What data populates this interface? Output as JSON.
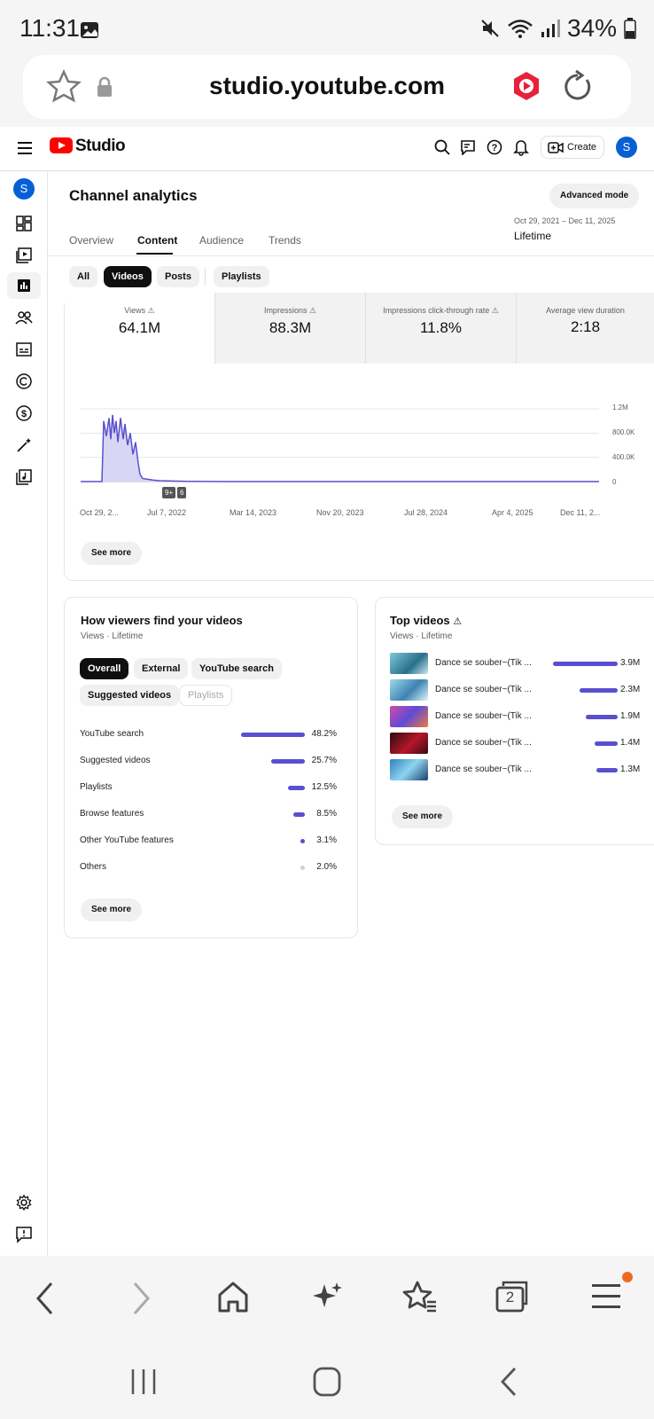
{
  "status": {
    "time": "11:31",
    "battery": "34%"
  },
  "browser": {
    "url": "studio.youtube.com",
    "tabs_count": "2"
  },
  "header": {
    "logo_text": "Studio",
    "create_label": "Create",
    "avatar": "S"
  },
  "sidebar": {
    "avatar": "S"
  },
  "page": {
    "title": "Channel analytics",
    "advanced_mode": "Advanced mode",
    "tabs": [
      "Overview",
      "Content",
      "Audience",
      "Trends"
    ],
    "active_tab": "Content",
    "date_range": "Oct 29, 2021 – Dec 11, 2025",
    "date_label": "Lifetime",
    "filters": [
      "All",
      "Videos",
      "Posts",
      "Playlists"
    ],
    "active_filter": "Videos"
  },
  "metrics": [
    {
      "label": "Views",
      "value": "64.1M"
    },
    {
      "label": "Impressions",
      "value": "88.3M"
    },
    {
      "label": "Impressions click-through rate",
      "value": "11.8%"
    },
    {
      "label": "Average view duration",
      "value": "2:18"
    }
  ],
  "chart_data": {
    "type": "area",
    "series": [
      {
        "name": "Views",
        "values": [
          0,
          0,
          1000000,
          700000,
          60000,
          5000,
          0,
          0,
          0,
          0,
          0
        ]
      }
    ],
    "x_ticks": [
      "Oct 29, 2...",
      "Jul 7, 2022",
      "Mar 14, 2023",
      "Nov 20, 2023",
      "Jul 28, 2024",
      "Apr 4, 2025",
      "Dec 11, 2..."
    ],
    "y_ticks": [
      "1.2M",
      "800.0K",
      "400.0K",
      "0"
    ],
    "ylim": [
      0,
      1200000
    ],
    "markers": [
      "9+",
      "6"
    ],
    "see_more": "See more"
  },
  "traffic": {
    "title": "How viewers find your videos",
    "subtitle": "Views · Lifetime",
    "chips": [
      "Overall",
      "External",
      "YouTube search",
      "Suggested videos",
      "Playlists"
    ],
    "sources": [
      {
        "label": "YouTube search",
        "pct": "48.2%",
        "value": 48.2
      },
      {
        "label": "Suggested videos",
        "pct": "25.7%",
        "value": 25.7
      },
      {
        "label": "Playlists",
        "pct": "12.5%",
        "value": 12.5
      },
      {
        "label": "Browse features",
        "pct": "8.5%",
        "value": 8.5
      },
      {
        "label": "Other YouTube features",
        "pct": "3.1%",
        "value": 3.1
      },
      {
        "label": "Others",
        "pct": "2.0%",
        "value": 2.0
      }
    ],
    "see_more": "See more"
  },
  "top_videos": {
    "title": "Top videos",
    "subtitle": "Views · Lifetime",
    "items": [
      {
        "title": "Dance se souber~(Tik ...",
        "views": "3.9M",
        "value": 3.9
      },
      {
        "title": "Dance se souber~(Tik ...",
        "views": "2.3M",
        "value": 2.3
      },
      {
        "title": "Dance se souber~(Tik ...",
        "views": "1.9M",
        "value": 1.9
      },
      {
        "title": "Dance se souber~(Tik ...",
        "views": "1.4M",
        "value": 1.4
      },
      {
        "title": "Dance se souber~(Tik ...",
        "views": "1.3M",
        "value": 1.3
      }
    ],
    "see_more": "See more"
  },
  "colors": {
    "accent": "#5a4fcf",
    "youtube_red": "#ff0000",
    "avatar_blue": "#065fd4"
  }
}
